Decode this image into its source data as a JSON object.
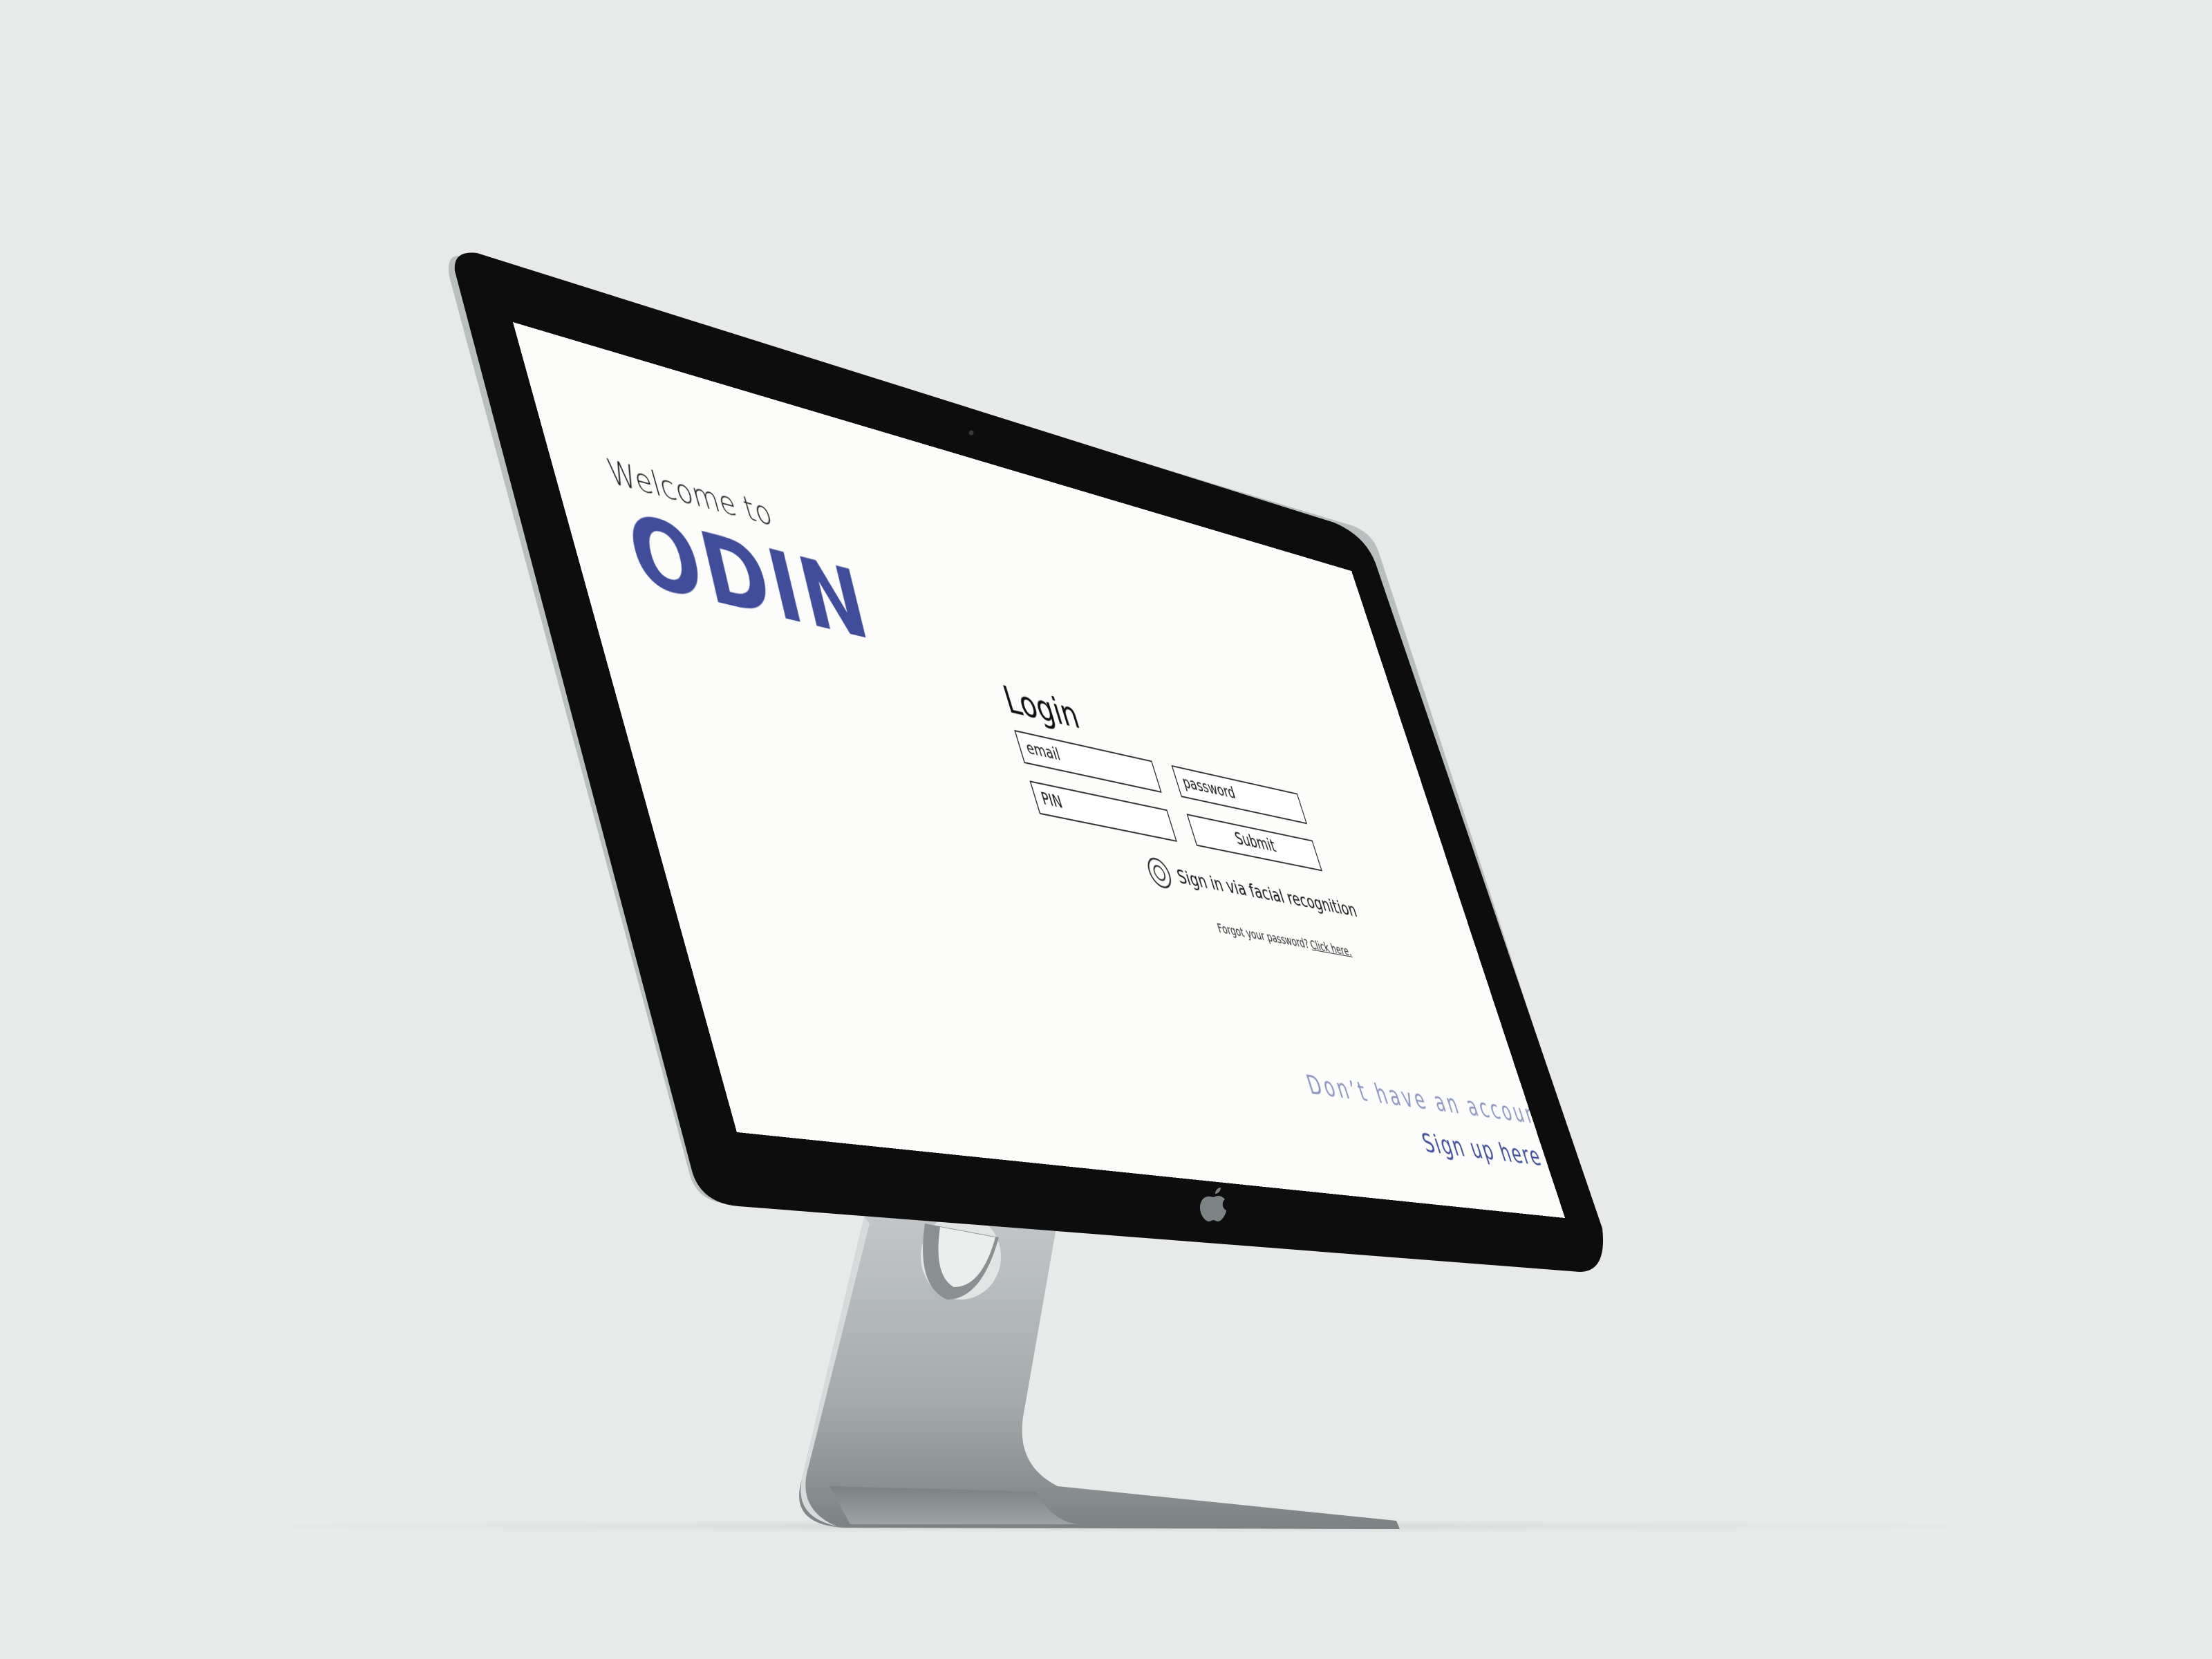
{
  "colors": {
    "background": "#e8eae9",
    "bezel": "#0c0d0c",
    "screen": "#fcfcfa",
    "brand": "#3f4d9a",
    "muted_brand": "#8d96bf",
    "stand": "#a9afb1"
  },
  "welcome": {
    "prefix": "Welcome to",
    "logo": "ODIN"
  },
  "login": {
    "title": "Login",
    "email_placeholder": "email",
    "password_placeholder": "password",
    "pin_placeholder": "PIN",
    "submit_label": "Submit",
    "face_recognition_label": "Sign in via facial recognition",
    "face_icon": "face-scan-icon",
    "forgot_text": "Forgot your password?",
    "forgot_link": "Click here."
  },
  "signup": {
    "prompt": "Don’t have an account yet?",
    "link": "Sign up here"
  },
  "device": {
    "logo_icon": "apple-logo-icon",
    "camera_icon": "camera-icon"
  }
}
